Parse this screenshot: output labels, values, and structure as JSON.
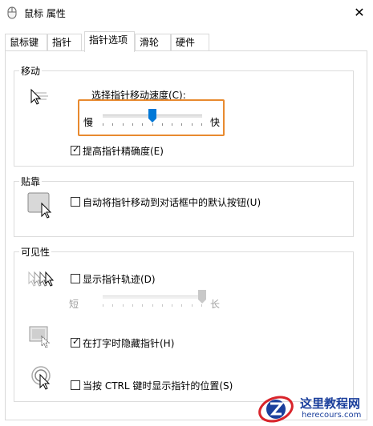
{
  "window": {
    "title": "鼠标 属性",
    "close_glyph": "✕"
  },
  "tabs": [
    {
      "label": "鼠标键"
    },
    {
      "label": "指针"
    },
    {
      "label": "指针选项"
    },
    {
      "label": "滑轮"
    },
    {
      "label": "硬件"
    }
  ],
  "active_tab": "指针选项",
  "motion": {
    "title": "移动",
    "speed_label": "选择指针移动速度(C):",
    "slow": "慢",
    "fast": "快",
    "speed_level": 0.5,
    "enhance_label": "提高指针精确度(E)",
    "enhance_checked": true
  },
  "snap": {
    "title": "贴靠",
    "snap_label": "自动将指针移动到对话框中的默认按钮(U)",
    "snap_checked": false
  },
  "visibility": {
    "title": "可见性",
    "trails_label": "显示指针轨迹(D)",
    "trails_checked": false,
    "short": "短",
    "long": "长",
    "trails_level": 1.0,
    "hide_label": "在打字时隐藏指针(H)",
    "hide_checked": true,
    "ctrl_label": "当按 CTRL 键时显示指针的位置(S)",
    "ctrl_checked": false
  },
  "watermark": {
    "line1": "这里教程网",
    "line2": "herecours.com"
  },
  "colors": {
    "accent": "#0078d7",
    "highlight": "#e88a2f",
    "brand": "#1b3f9c"
  },
  "icons": [
    "mouse-icon",
    "close-icon",
    "pointer-speed-icon",
    "snap-to-icon",
    "pointer-trails-icon",
    "hide-pointer-icon",
    "show-location-icon",
    "checkmark-icon",
    "watermark-logo"
  ]
}
